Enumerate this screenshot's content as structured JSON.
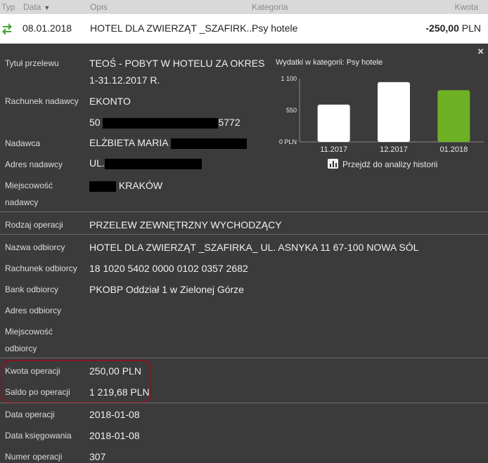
{
  "header": {
    "col_typ": "Typ",
    "col_data": "Data",
    "col_opis": "Opis",
    "col_kategoria": "Kategoria",
    "col_kwota": "Kwota"
  },
  "transaction": {
    "type_icon": "transfer-arrows-icon",
    "date": "08.01.2018",
    "description": "HOTEL DLA ZWIERZĄT _SZAFIRK...",
    "category": "Psy hotele",
    "amount": "-250,00",
    "currency": "PLN"
  },
  "details": {
    "close_symbol": "×",
    "fields": {
      "tytul_label": "Tytuł przelewu",
      "tytul_line1": "TEOŚ - POBYT W HOTELU ZA OKRES",
      "tytul_line2": "1-31.12.2017 R.",
      "rachunek_nadawcy_label": "Rachunek nadawcy",
      "rachunek_nadawcy_line1": "EKONTO",
      "rachunek_nadawcy_prefix": "50",
      "rachunek_nadawcy_suffix": "5772",
      "nadawca_label": "Nadawca",
      "nadawca_value": "ELŻBIETA MARIA",
      "adres_nadawcy_label": "Adres nadawcy",
      "adres_nadawcy_value": "UL.",
      "miejscowosc_nadawcy_label1": "Miejscowość",
      "miejscowosc_nadawcy_label2": "nadawcy",
      "miejscowosc_nadawcy_value": "KRAKÓW",
      "rodzaj_label": "Rodzaj operacji",
      "rodzaj_value": "PRZELEW ZEWNĘTRZNY WYCHODZĄCY",
      "nazwa_odbiorcy_label": "Nazwa odbiorcy",
      "nazwa_odbiorcy_value": "HOTEL DLA ZWIERZĄT _SZAFIRKA_ UL. ASNYKA 11 67-100 NOWA SÓL",
      "rachunek_odbiorcy_label": "Rachunek odbiorcy",
      "rachunek_odbiorcy_value": "18 1020 5402 0000 0102 0357 2682",
      "bank_odbiorcy_label": "Bank odbiorcy",
      "bank_odbiorcy_value": "PKOBP Oddział 1 w Zielonej Górze",
      "adres_odbiorcy_label": "Adres odbiorcy",
      "miejscowosc_odbiorcy_label1": "Miejscowość",
      "miejscowosc_odbiorcy_label2": "odbiorcy",
      "kwota_label": "Kwota operacji",
      "kwota_value": "250,00 PLN",
      "saldo_label": "Saldo po operacji",
      "saldo_value": "1 219,68 PLN",
      "data_operacji_label": "Data operacji",
      "data_operacji_value": "2018-01-08",
      "data_ksiegowania_label": "Data księgowania",
      "data_ksiegowania_value": "2018-01-08",
      "numer_label": "Numer operacji",
      "numer_value": "307"
    }
  },
  "chart_data": {
    "type": "bar",
    "title": "Wydatki w kategorii:  Psy hotele",
    "categories": [
      "11.2017",
      "12.2017",
      "01.2018"
    ],
    "values": [
      650,
      1040,
      900
    ],
    "ylim": [
      0,
      1100
    ],
    "yticks": [
      "0 PLN",
      "550",
      "1 100"
    ],
    "colors": [
      "#ffffff",
      "#ffffff",
      "#6fb125"
    ]
  },
  "analyze_link": {
    "icon": "bar-chart-icon",
    "label": "Przejdź do analizy historii"
  }
}
